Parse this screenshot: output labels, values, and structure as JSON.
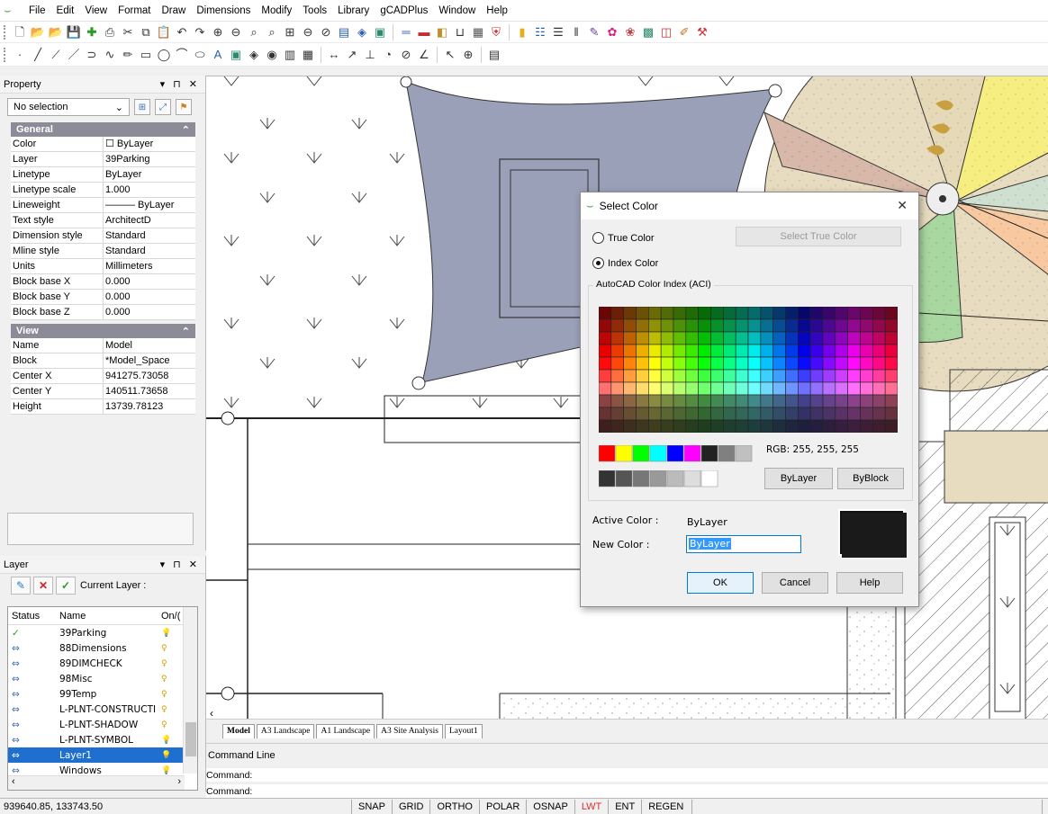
{
  "menu": [
    "File",
    "Edit",
    "View",
    "Format",
    "Draw",
    "Dimensions",
    "Modify",
    "Tools",
    "Library",
    "gCADPlus",
    "Window",
    "Help"
  ],
  "property_panel": {
    "title": "Property",
    "controls": "▾ ⊓ ✕",
    "selection": "No selection",
    "general_title": "General",
    "general_rows": [
      {
        "k": "Color",
        "v": "☐ ByLayer"
      },
      {
        "k": "Layer",
        "v": "39Parking"
      },
      {
        "k": "Linetype",
        "v": "ByLayer"
      },
      {
        "k": "Linetype scale",
        "v": "1.000"
      },
      {
        "k": "Lineweight",
        "v": "——— ByLayer"
      },
      {
        "k": "Text style",
        "v": "ArchitectD"
      },
      {
        "k": "Dimension style",
        "v": "Standard"
      },
      {
        "k": "Mline style",
        "v": "Standard"
      },
      {
        "k": "Units",
        "v": "Millimeters"
      },
      {
        "k": "Block base X",
        "v": "0.000"
      },
      {
        "k": "Block base Y",
        "v": "0.000"
      },
      {
        "k": "Block base Z",
        "v": "0.000"
      }
    ],
    "view_title": "View",
    "view_rows": [
      {
        "k": "Name",
        "v": "Model"
      },
      {
        "k": "Block",
        "v": "*Model_Space"
      },
      {
        "k": "Center X",
        "v": "941275.73058"
      },
      {
        "k": "Center Y",
        "v": "140511.73658"
      },
      {
        "k": "Height",
        "v": "13739.78123"
      }
    ]
  },
  "layer_panel": {
    "title": "Layer",
    "controls": "▾ ⊓ ✕",
    "current_layer_label": "Current Layer :",
    "headers": {
      "status": "Status",
      "name": "Name",
      "on": "On/("
    },
    "layers": [
      {
        "name": "39Parking",
        "status": "✓",
        "on": "💡"
      },
      {
        "name": "88Dimensions",
        "status": "⇔",
        "on": "♀"
      },
      {
        "name": "89DIMCHECK",
        "status": "⇔",
        "on": "♀"
      },
      {
        "name": "98Misc",
        "status": "⇔",
        "on": "♀"
      },
      {
        "name": "99Temp",
        "status": "⇔",
        "on": "♀"
      },
      {
        "name": "L-PLNT-CONSTRUCTI",
        "status": "⇔",
        "on": "♀"
      },
      {
        "name": "L-PLNT-SHADOW",
        "status": "⇔",
        "on": "♀"
      },
      {
        "name": "L-PLNT-SYMBOL",
        "status": "⇔",
        "on": "💡"
      },
      {
        "name": "Layer1",
        "status": "⇔",
        "on": "💡",
        "selected": true
      },
      {
        "name": "Windows",
        "status": "⇔",
        "on": "💡"
      }
    ]
  },
  "tabs": [
    "Model",
    "A3 Landscape",
    "A1 Landscape",
    "A3 Site Analysis",
    "Layout1"
  ],
  "command": {
    "title": "Command Line",
    "line1": "Command:",
    "line2": "Command:"
  },
  "status_bar": {
    "coords": "939640.85, 133743.50",
    "buttons": [
      {
        "label": "SNAP",
        "on": false
      },
      {
        "label": "GRID",
        "on": false
      },
      {
        "label": "ORTHO",
        "on": false
      },
      {
        "label": "POLAR",
        "on": false
      },
      {
        "label": "OSNAP",
        "on": false
      },
      {
        "label": "LWT",
        "on": true
      },
      {
        "label": "ENT",
        "on": false
      },
      {
        "label": "REGEN",
        "on": false
      }
    ]
  },
  "dialog": {
    "title": "Select Color",
    "close": "✕",
    "true_color": "True Color",
    "select_true_color": "Select True Color",
    "index_color": "Index Color",
    "group_label": "AutoCAD Color Index (ACI)",
    "rgb": "RGB: 255, 255, 255",
    "bylayer_button": "ByLayer",
    "byblock_button": "ByBlock",
    "active_color_label": "Active Color :",
    "active_color_value": "ByLayer",
    "new_color_label": "New Color :",
    "new_color_value": "ByLayer",
    "ok": "OK",
    "cancel": "Cancel",
    "help": "Help",
    "standard_colors": [
      "#ff0000",
      "#ffff00",
      "#00ff00",
      "#00ffff",
      "#0000ff",
      "#ff00ff",
      "#222222",
      "#808080",
      "#c0c0c0"
    ],
    "gray_colors": [
      "#333333",
      "#555555",
      "#777777",
      "#999999",
      "#bbbbbb",
      "#dddddd",
      "#ffffff"
    ]
  },
  "colors": {
    "accent": "#0078d7",
    "selected_row": "#1e6fd0",
    "star_shape": "#9aa0b8",
    "lwt_on": "#e03030"
  }
}
